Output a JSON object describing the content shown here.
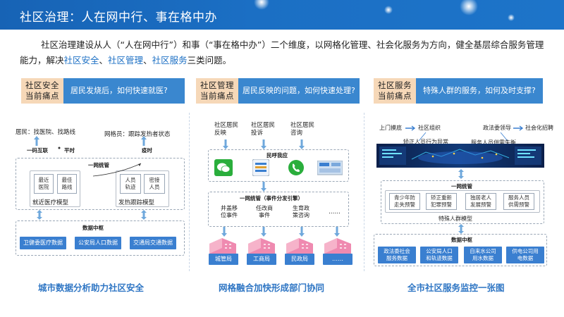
{
  "header": {
    "title": "社区治理：人在网中行、事在格中办"
  },
  "intro": {
    "p1": "社区治理建设从人（“人在网中行”）和事（“事在格中办”）二个维度，以网格化管理、社会化服务为方向，健全基层综合服务管理能力，解决",
    "k1": "社区安全",
    "s1": "、",
    "k2": "社区管理",
    "s2": "、",
    "k3": "社区服务",
    "p2": "三类问题。"
  },
  "pain_points": [
    {
      "tag1": "社区安全",
      "tag2": "当前痛点",
      "question": "居民发烧后，如何快速就医?"
    },
    {
      "tag1": "社区管理",
      "tag2": "当前痛点",
      "question": "居民反映的问题，如何快速处理?"
    },
    {
      "tag1": "社区服务",
      "tag2": "当前痛点",
      "question": "特殊人群的服务，如何及时支撑?"
    }
  ],
  "panel1": {
    "resident": "居民：找医院、找路线",
    "grid_staff": "网格员：跟踪发热者状态",
    "one_click": "一码互联",
    "wartime": "平时",
    "epidemic": "疫时",
    "unified": "一网统管",
    "nearest_hosp": "最近医院",
    "best_route": "最佳路线",
    "med_model": "就近医疗模型",
    "person_track": "人员轨迹",
    "close_contact": "密接人员",
    "fever_model": "发热跟踪模型",
    "data_hub": "数据中枢",
    "src1": "卫健委医疗数据",
    "src2": "公安局人口数据",
    "src3": "交通局交通数据",
    "caption": "城市数据分析助力社区安全"
  },
  "panel2": {
    "r1": "社区居民反映",
    "r2": "社区居民投诉",
    "r3": "社区居民咨询",
    "hotline": "民呼我应",
    "unified": "一网统管（事件分发引擎）",
    "ev1": "井盖移位事件",
    "ev2": "任改商事件",
    "ev3": "生育政策咨询",
    "ev4": "……",
    "dept1": "城管局",
    "dept2": "工商局",
    "dept3": "民政局",
    "dept4": "……",
    "caption": "网格融合加快形成部门协同"
  },
  "panel3": {
    "visit": "上门摸底",
    "org": "社区组织",
    "law": "政法委领导",
    "social": "社会化招聘",
    "abnormal": "矫正人员行为异常",
    "shortage": "服务人员供需失衡",
    "unified": "一网统管",
    "w1": "青少年防走失预警",
    "w2": "矫正重新犯罪预警",
    "w3": "独居老人发展预警",
    "w4": "服务人员供需预警",
    "group_model": "特殊人群模型",
    "data_hub": "数据中枢",
    "src1": "政法委社会服务数据",
    "src2": "公安局人口和轨迹数据",
    "src3": "自来水公司用水数据",
    "src4": "供电公司用电数据",
    "caption": "全市社区服务监控一张图"
  },
  "colors": {
    "primary": "#1b6fc4",
    "tag_bg": "#f6d8b8",
    "question_bg": "#3a87cf",
    "caption": "#2f76c4"
  }
}
